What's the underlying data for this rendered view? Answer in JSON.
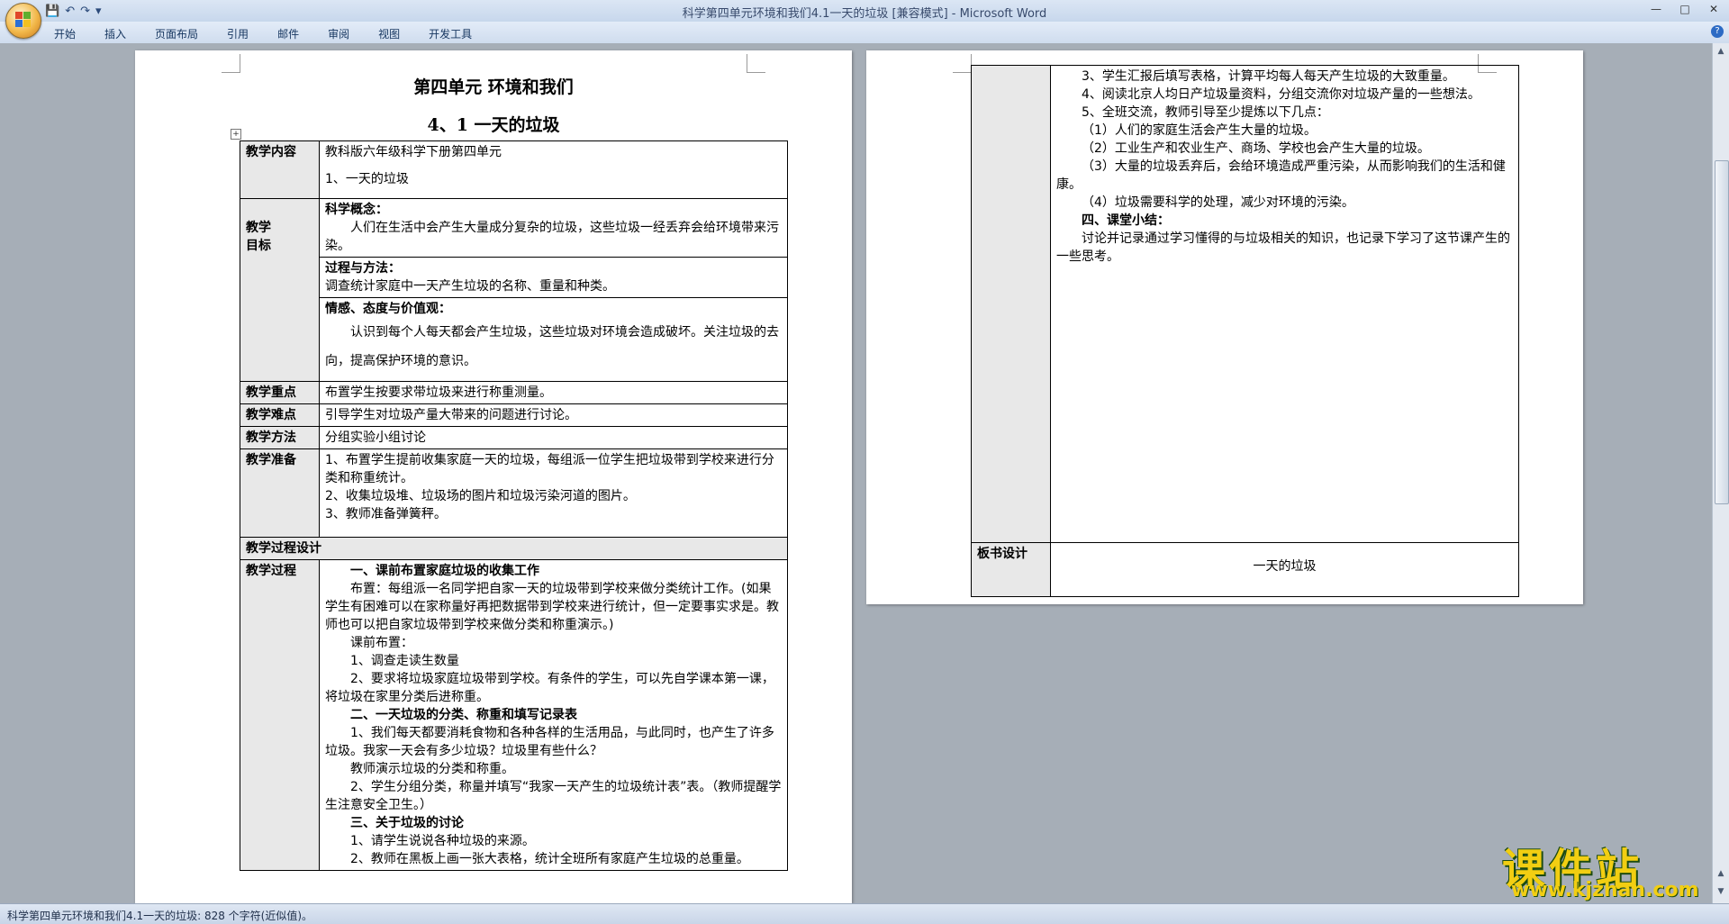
{
  "window": {
    "title": "科学第四单元环境和我们4.1一天的垃圾 [兼容模式] - Microsoft Word",
    "qat": {
      "save": "💾",
      "undo": "↶",
      "redo": "↷",
      "more": "▾"
    },
    "controls": {
      "min": "—",
      "max": "□",
      "close": "✕"
    }
  },
  "ribbon": {
    "tabs": [
      "开始",
      "插入",
      "页面布局",
      "引用",
      "邮件",
      "审阅",
      "视图",
      "开发工具"
    ],
    "help": "?"
  },
  "page1": {
    "heading1": "第四单元  环境和我们",
    "heading2": "4、1  一天的垃圾",
    "table": {
      "r1": {
        "label": "教学内容",
        "lines": [
          "教科版六年级科学下册第四单元",
          "1、一天的垃圾"
        ]
      },
      "r2": {
        "label": "教学目标",
        "sec1_title": "科学概念：",
        "sec1_text": "人们在生活中会产生大量成分复杂的垃圾，这些垃圾一经丢弃会给环境带来污染。",
        "sec2_title": "过程与方法：",
        "sec2_text": "调查统计家庭中一天产生垃圾的名称、重量和种类。",
        "sec3_title": "情感、态度与价值观：",
        "sec3_text": "认识到每个人每天都会产生垃圾，这些垃圾对环境会造成破坏。关注垃圾的去向，提高保护环境的意识。"
      },
      "r3": {
        "label": "教学重点",
        "text": "布置学生按要求带垃圾来进行称重测量。"
      },
      "r4": {
        "label": "教学难点",
        "text": "引导学生对垃圾产量大带来的问题进行讨论。"
      },
      "r5": {
        "label": "教学方法",
        "text": "分组实验小组讨论"
      },
      "r6": {
        "label": "教学准备",
        "lines": [
          "1、布置学生提前收集家庭一天的垃圾，每组派一位学生把垃圾带到学校来进行分类和称重统计。",
          "2、收集垃圾堆、垃圾场的图片和垃圾污染河道的图片。",
          "3、教师准备弹簧秤。"
        ]
      },
      "r7": {
        "label": "教学过程设计"
      },
      "r8": {
        "label": "教学过程",
        "lines": [
          "一、课前布置家庭垃圾的收集工作",
          "布置：每组派一名同学把自家一天的垃圾带到学校来做分类统计工作。(如果学生有困难可以在家称量好再把数据带到学校来进行统计，但一定要事实求是。教师也可以把自家垃圾带到学校来做分类和称重演示。)",
          "课前布置：",
          "1、调查走读生数量",
          "2、要求将垃圾家庭垃圾带到学校。有条件的学生，可以先自学课本第一课，将垃圾在家里分类后进称重。",
          "二、一天垃圾的分类、称重和填写记录表",
          "1、我们每天都要消耗食物和各种各样的生活用品，与此同时，也产生了许多垃圾。我家一天会有多少垃圾？垃圾里有些什么？",
          "教师演示垃圾的分类和称重。",
          "2、学生分组分类，称量并填写“我家一天产生的垃圾统计表”表。（教师提醒学生注意安全卫生。）",
          "三、关于垃圾的讨论",
          "1、请学生说说各种垃圾的来源。",
          "2、教师在黑板上画一张大表格，统计全班所有家庭产生垃圾的总重量。"
        ]
      }
    }
  },
  "page2": {
    "lines": [
      "3、学生汇报后填写表格，计算平均每人每天产生垃圾的大致重量。",
      "4、阅读北京人均日产垃圾量资料，分组交流你对垃圾产量的一些想法。",
      "5、全班交流，教师引导至少提炼以下几点：",
      "（1）人们的家庭生活会产生大量的垃圾。",
      "（2）工业生产和农业生产、商场、学校也会产生大量的垃圾。",
      "（3）大量的垃圾丢弃后，会给环境造成严重污染，从而影响我们的生活和健康。",
      "（4）垃圾需要科学的处理，减少对环境的污染。",
      "四、课堂小结：",
      "讨论并记录通过学习懂得的与垃圾相关的知识，也记录下学习了这节课产生的一些思考。"
    ],
    "board_label": "板书设计",
    "board_text": "一天的垃圾"
  },
  "statusbar": {
    "text": "科学第四单元环境和我们4.1一天的垃圾: 828 个字符(近似值)。"
  },
  "watermark": {
    "title": "课件站",
    "url": "www.kjzhan.com"
  }
}
